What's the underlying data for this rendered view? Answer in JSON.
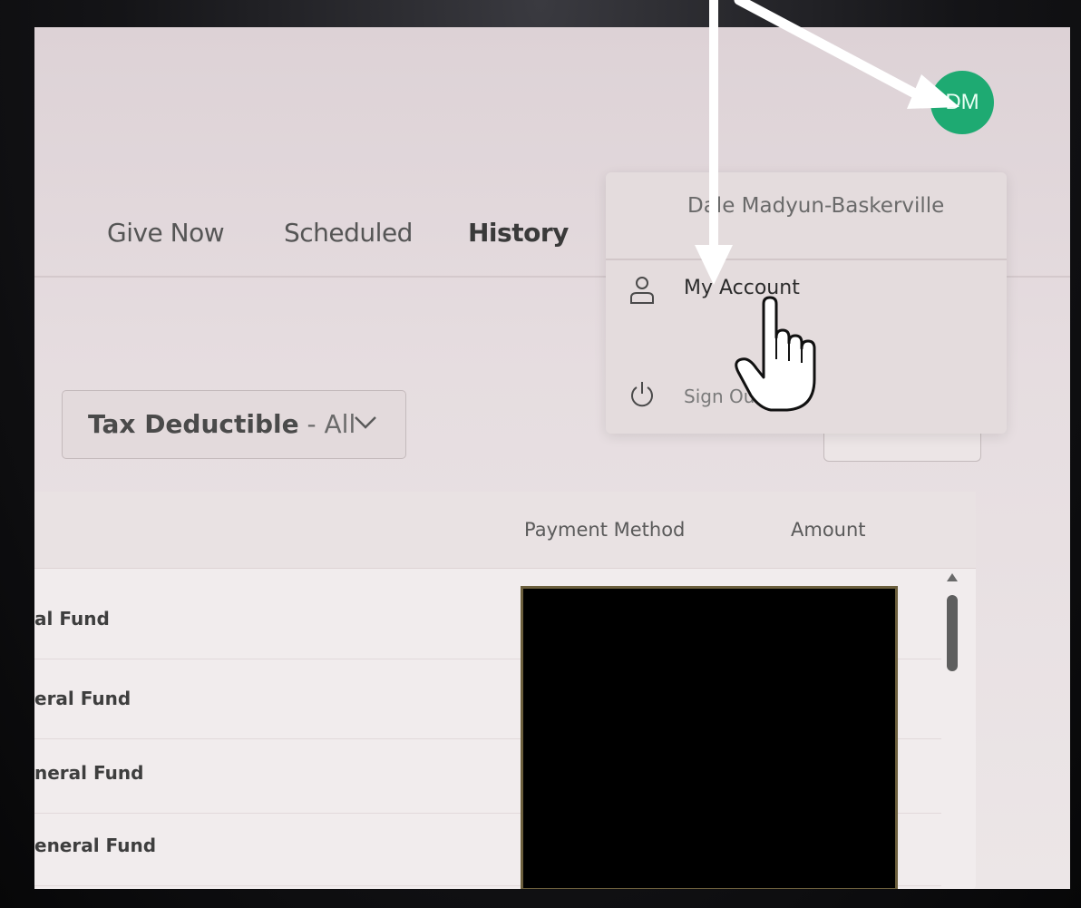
{
  "nav": {
    "tabs": [
      {
        "label": "Give Now",
        "active": false
      },
      {
        "label": "Scheduled",
        "active": false
      },
      {
        "label": "History",
        "active": true
      }
    ]
  },
  "user": {
    "initials": "DM",
    "full_name": "Dale Madyun-Baskerville",
    "avatar_color": "#1eaa72"
  },
  "menu": {
    "items": [
      {
        "label": "My Account",
        "icon": "person-icon"
      },
      {
        "label": "Sign Out",
        "icon": "power-icon"
      }
    ]
  },
  "filter": {
    "label": "Tax Deductible",
    "separator": " - ",
    "value": "All"
  },
  "table": {
    "headers": {
      "payment_method": "Payment Method",
      "amount": "Amount"
    },
    "rows": [
      {
        "fund": "al Fund"
      },
      {
        "fund": "eral Fund"
      },
      {
        "fund": "neral Fund"
      },
      {
        "fund": "eneral Fund"
      }
    ]
  },
  "annotations": {
    "arrow_color": "#ffffff",
    "redaction_color": "#000000"
  }
}
